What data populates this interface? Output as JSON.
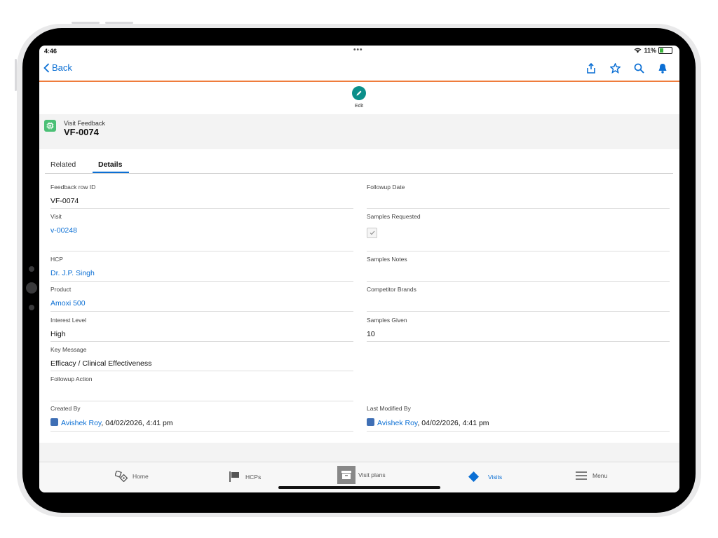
{
  "status_bar": {
    "time": "4:46",
    "dots": "•••",
    "battery": "11%"
  },
  "nav": {
    "back_label": "Back"
  },
  "actions": {
    "edit_label": "Edit"
  },
  "record": {
    "type": "Visit Feedback",
    "name": "VF-0074"
  },
  "tabs": [
    {
      "label": "Related",
      "active": false
    },
    {
      "label": "Details",
      "active": true
    }
  ],
  "fields": {
    "feedback_row_id": {
      "label": "Feedback row ID",
      "value": "VF-0074"
    },
    "followup_date": {
      "label": "Followup Date",
      "value": ""
    },
    "visit": {
      "label": "Visit",
      "value": "v-00248"
    },
    "samples_requested": {
      "label": "Samples Requested",
      "checked": true
    },
    "hcp": {
      "label": "HCP",
      "value": "Dr. J.P. Singh"
    },
    "samples_notes": {
      "label": "Samples Notes",
      "value": ""
    },
    "product": {
      "label": "Product",
      "value": "Amoxi 500"
    },
    "competitor_brands": {
      "label": "Competitor Brands",
      "value": ""
    },
    "interest_level": {
      "label": "Interest Level",
      "value": "High"
    },
    "samples_given": {
      "label": "Samples Given",
      "value": "10"
    },
    "key_message": {
      "label": "Key Message",
      "value": "Efficacy / Clinical Effectiveness"
    },
    "followup_action": {
      "label": "Followup Action",
      "value": ""
    },
    "created_by": {
      "label": "Created By",
      "user": "Avishek Roy",
      "date": ", 04/02/2026, 4:41 pm"
    },
    "last_modified_by": {
      "label": "Last Modified By",
      "user": "Avishek Roy",
      "date": ", 04/02/2026, 4:41 pm"
    }
  },
  "tabbar": [
    {
      "label": "Home",
      "icon": "home-icon"
    },
    {
      "label": "HCPs",
      "icon": "flag-icon"
    },
    {
      "label": "Visit plans",
      "icon": "archive-icon"
    },
    {
      "label": "Visits",
      "icon": "diamond-icon",
      "active": true
    },
    {
      "label": "Menu",
      "icon": "menu-icon"
    }
  ],
  "colors": {
    "accent": "#0b6fd4",
    "nav_border": "#ef7c3c",
    "edit": "#0b8f8a",
    "record_icon": "#4bc076"
  }
}
